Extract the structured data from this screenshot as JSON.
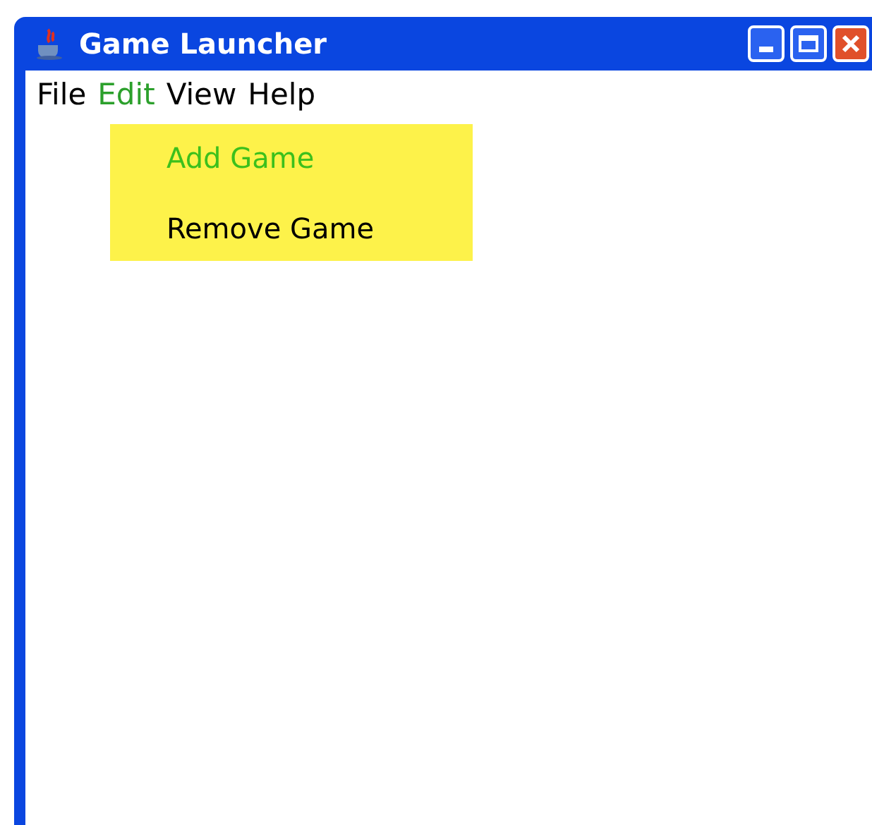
{
  "window": {
    "title": "Game Launcher"
  },
  "menu_bar": [
    {
      "label": "File",
      "selected": false
    },
    {
      "label": "Edit",
      "selected": true
    },
    {
      "label": "View",
      "selected": false
    },
    {
      "label": "Help",
      "selected": false
    }
  ],
  "dropdown": [
    {
      "label": "Add Game",
      "selected": true
    },
    {
      "label": "Remove Game",
      "selected": false
    }
  ]
}
